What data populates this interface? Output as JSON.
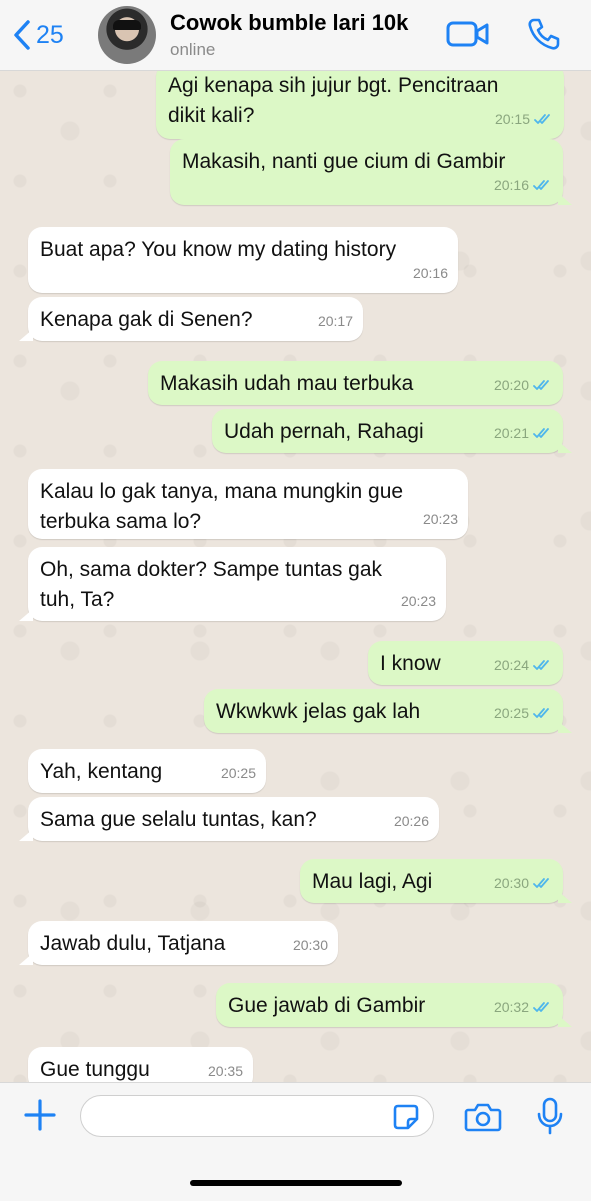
{
  "header": {
    "back_count": "25",
    "contact_name": "Cowok bumble lari 10k",
    "status": "online"
  },
  "messages": [
    {
      "dir": "out",
      "text": "Agi kenapa sih jujur bgt. Pencitraan\ndikit kali?",
      "time": "20:15",
      "read": true
    },
    {
      "dir": "out",
      "text": "Makasih, nanti gue cium di Gambir",
      "time": "20:16",
      "read": true
    },
    {
      "dir": "in",
      "text": "Buat apa? You know my dating history",
      "time": "20:16"
    },
    {
      "dir": "in",
      "text": "Kenapa gak di Senen?",
      "time": "20:17"
    },
    {
      "dir": "out",
      "text": "Makasih udah mau terbuka",
      "time": "20:20",
      "read": true
    },
    {
      "dir": "out",
      "text": "Udah pernah, Rahagi",
      "time": "20:21",
      "read": true
    },
    {
      "dir": "in",
      "text": "Kalau lo gak tanya, mana mungkin gue\nterbuka sama lo?",
      "time": "20:23"
    },
    {
      "dir": "in",
      "text": "Oh, sama dokter? Sampe tuntas gak\ntuh, Ta?",
      "time": "20:23"
    },
    {
      "dir": "out",
      "text": "I know",
      "time": "20:24",
      "read": true
    },
    {
      "dir": "out",
      "text": "Wkwkwk jelas gak lah",
      "time": "20:25",
      "read": true
    },
    {
      "dir": "in",
      "text": "Yah, kentang",
      "time": "20:25"
    },
    {
      "dir": "in",
      "text": "Sama gue selalu tuntas, kan?",
      "time": "20:26"
    },
    {
      "dir": "out",
      "text": "Mau lagi, Agi",
      "time": "20:30",
      "read": true
    },
    {
      "dir": "in",
      "text": "Jawab dulu, Tatjana",
      "time": "20:30"
    },
    {
      "dir": "out",
      "text": "Gue jawab di Gambir",
      "time": "20:32",
      "read": true
    },
    {
      "dir": "in",
      "text": "Gue tunggu",
      "time": "20:35"
    }
  ],
  "composer": {
    "placeholder": ""
  },
  "colors": {
    "accent": "#1e82f4",
    "outgoing": "#dcf8c6",
    "incoming": "#ffffff",
    "read_tick": "#4fb6ec"
  }
}
